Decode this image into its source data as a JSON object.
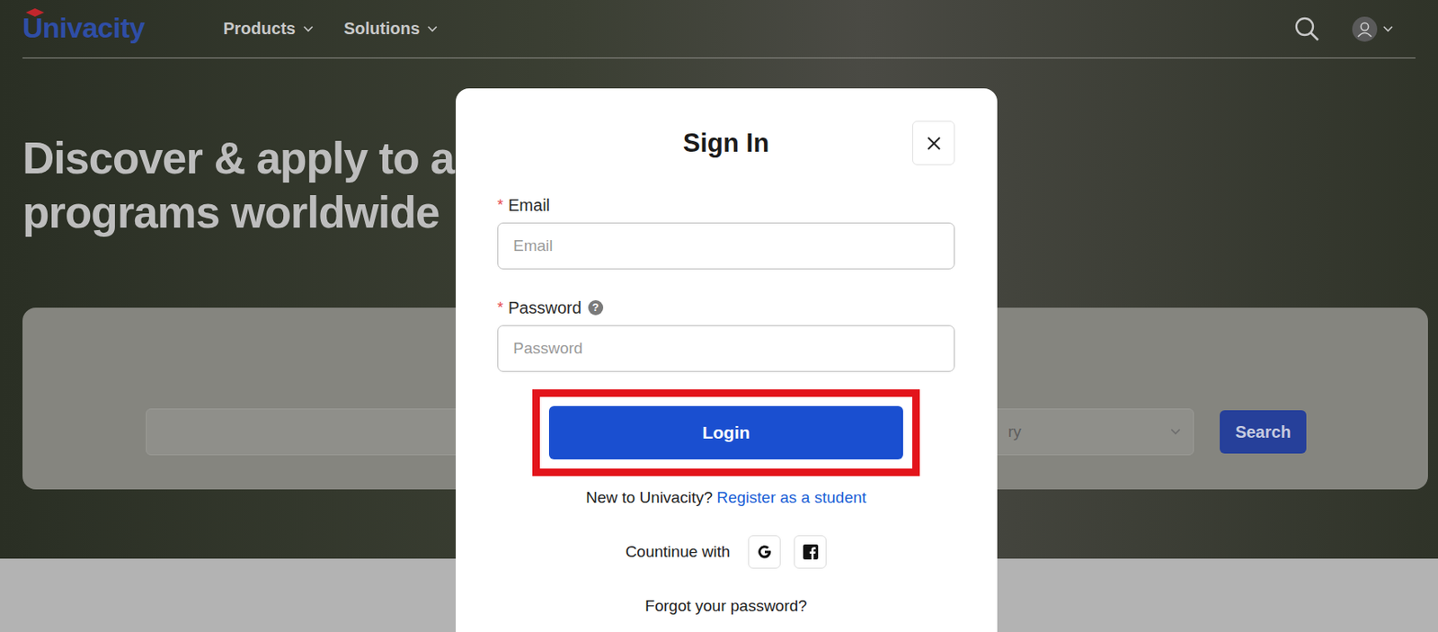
{
  "header": {
    "logo": "Univacity",
    "nav": [
      {
        "label": "Products"
      },
      {
        "label": "Solutions"
      }
    ]
  },
  "hero": {
    "title_lines": [
      "Discover & apply to a",
      "programs worldwide"
    ]
  },
  "search_bar": {
    "keyword_placeholder": "",
    "country_placeholder": "ry",
    "button": "Search"
  },
  "dialog": {
    "title": "Sign In",
    "fields": [
      {
        "label": "Email",
        "required": true,
        "required_mark": "*",
        "help": "",
        "placeholder": "Email",
        "kind": "text"
      },
      {
        "label": "Password",
        "required": true,
        "required_mark": "*",
        "help": "?",
        "placeholder": "Password",
        "kind": "password"
      }
    ],
    "login_button": {
      "label": "Login",
      "highlighted": true
    },
    "register": {
      "prompt": "New to Univacity?",
      "link": "Register as a student"
    },
    "social": {
      "label": "Countinue with",
      "providers": [
        {
          "name": "google"
        },
        {
          "name": "facebook"
        }
      ]
    },
    "forgot": "Forgot your password?"
  }
}
